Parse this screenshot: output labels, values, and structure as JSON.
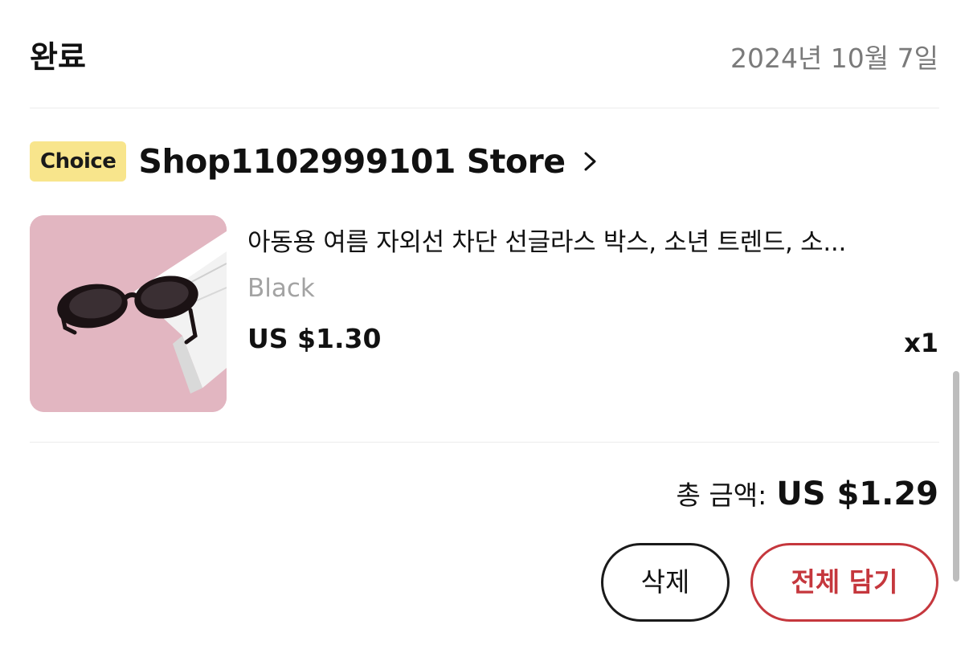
{
  "order": {
    "status": "완료",
    "date": "2024년 10월 7일"
  },
  "store": {
    "badge": "Choice",
    "name": "Shop1102999101 Store"
  },
  "product": {
    "title": "아동용 여름 자외선 차단 선글라스 박스, 소년 트렌드, 소...",
    "variant": "Black",
    "price": "US $1.30",
    "quantity": "x1",
    "image": "black-oval-sunglasses-on-pink-background"
  },
  "summary": {
    "total_label": "총 금액:",
    "total_amount": "US $1.29"
  },
  "actions": {
    "delete_label": "삭제",
    "add_all_label": "전체 담기"
  },
  "colors": {
    "choice_badge": "#f8e58c",
    "accent_red": "#c5373d",
    "muted_text": "#7a7a7a",
    "image_bg": "#e2b6c1"
  },
  "icons": {
    "store_chevron": "chevron-right-icon"
  }
}
